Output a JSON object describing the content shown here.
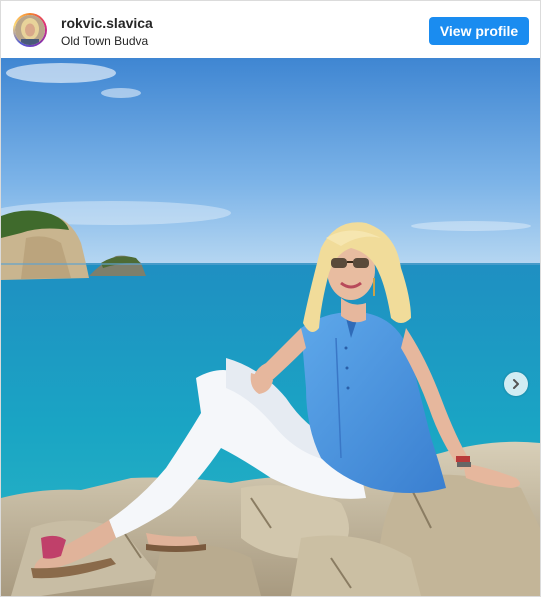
{
  "post": {
    "username": "rokvic.slavica",
    "location": "Old Town Budva",
    "view_profile_label": "View profile"
  },
  "icons": {
    "avatar": "profile-photo",
    "next": "chevron-right-icon"
  },
  "colors": {
    "accent": "#1a8cf0",
    "sky_top": "#4a8ed6",
    "sea": "#1aa7c9"
  }
}
